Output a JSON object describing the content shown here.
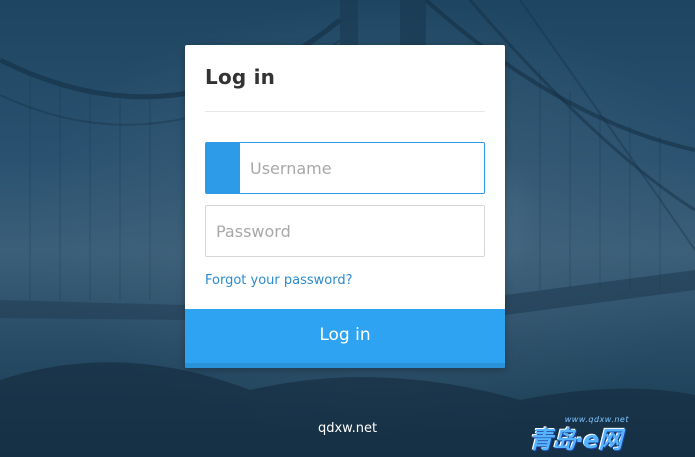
{
  "login": {
    "title": "Log in",
    "username_placeholder": "Username",
    "password_placeholder": "Password",
    "forgot_link": "Forgot your password?",
    "submit_label": "Log in"
  },
  "footer": {
    "site": "qdxw.net"
  },
  "watermark": {
    "url": "www.qdxw.net",
    "text": "青岛·e网"
  },
  "colors": {
    "accent": "#2ea3f2",
    "link": "#2a8bd0",
    "background": "#21465f"
  },
  "icons": {
    "username_field_accent": "field-accent-block"
  }
}
